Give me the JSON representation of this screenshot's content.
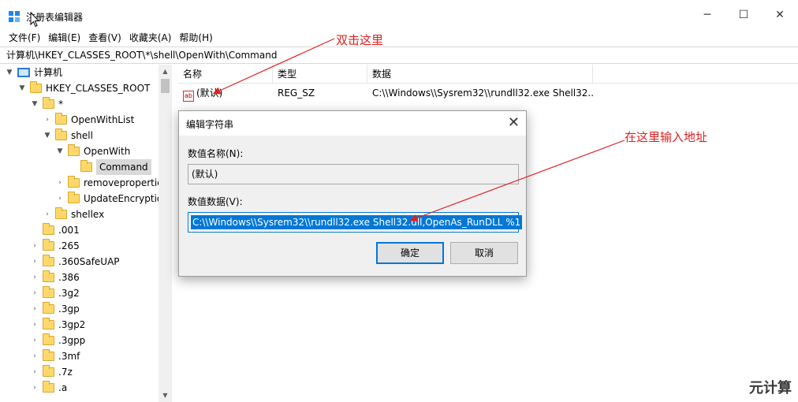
{
  "window": {
    "title": "注册表编辑器",
    "minimize_glyph": "─",
    "maximize_glyph": "☐",
    "close_glyph": "✕"
  },
  "menu": [
    "文件(F)",
    "编辑(E)",
    "查看(V)",
    "收藏夹(A)",
    "帮助(H)"
  ],
  "address": "计算机\\HKEY_CLASSES_ROOT\\*\\shell\\OpenWith\\Command",
  "tree": [
    {
      "label": "计算机",
      "twisty": "▼",
      "indent": 0,
      "icon": "computer"
    },
    {
      "label": "HKEY_CLASSES_ROOT",
      "twisty": "▼",
      "indent": 1,
      "icon": "folder"
    },
    {
      "label": "*",
      "twisty": "▼",
      "indent": 2,
      "icon": "folder"
    },
    {
      "label": "OpenWithList",
      "twisty": "›",
      "indent": 3,
      "icon": "folder"
    },
    {
      "label": "shell",
      "twisty": "▼",
      "indent": 3,
      "icon": "folder"
    },
    {
      "label": "OpenWith",
      "twisty": "▼",
      "indent": 4,
      "icon": "folder"
    },
    {
      "label": "Command",
      "twisty": "",
      "indent": 5,
      "icon": "folder",
      "selected": true
    },
    {
      "label": "removepropertie",
      "twisty": "›",
      "indent": 4,
      "icon": "folder"
    },
    {
      "label": "UpdateEncryptio",
      "twisty": "›",
      "indent": 4,
      "icon": "folder"
    },
    {
      "label": "shellex",
      "twisty": "›",
      "indent": 3,
      "icon": "folder"
    },
    {
      "label": ".001",
      "twisty": "",
      "indent": 2,
      "icon": "folder"
    },
    {
      "label": ".265",
      "twisty": "›",
      "indent": 2,
      "icon": "folder"
    },
    {
      "label": ".360SafeUAP",
      "twisty": "›",
      "indent": 2,
      "icon": "folder"
    },
    {
      "label": ".386",
      "twisty": "›",
      "indent": 2,
      "icon": "folder"
    },
    {
      "label": ".3g2",
      "twisty": "›",
      "indent": 2,
      "icon": "folder"
    },
    {
      "label": ".3gp",
      "twisty": "›",
      "indent": 2,
      "icon": "folder"
    },
    {
      "label": ".3gp2",
      "twisty": "›",
      "indent": 2,
      "icon": "folder"
    },
    {
      "label": ".3gpp",
      "twisty": "›",
      "indent": 2,
      "icon": "folder"
    },
    {
      "label": ".3mf",
      "twisty": "›",
      "indent": 2,
      "icon": "folder"
    },
    {
      "label": ".7z",
      "twisty": "›",
      "indent": 2,
      "icon": "folder"
    },
    {
      "label": ".a",
      "twisty": "›",
      "indent": 2,
      "icon": "folder"
    }
  ],
  "list": {
    "headers": [
      "名称",
      "类型",
      "数据"
    ],
    "rows": [
      {
        "icon": "ab",
        "name": "(默认)",
        "type": "REG_SZ",
        "data": "C:\\\\Windows\\\\Sysrem32\\\\rundll32.exe Shell32..."
      }
    ]
  },
  "dialog": {
    "title": "编辑字符串",
    "close_glyph": "✕",
    "name_label": "数值名称(N):",
    "name_value": "(默认)",
    "data_label": "数值数据(V):",
    "data_value": "C:\\\\Windows\\\\Sysrem32\\\\rundll32.exe Shell32.dll,OpenAs_RunDLL %1",
    "ok_label": "确定",
    "cancel_label": "取消"
  },
  "annotations": {
    "double_click": "双击这里",
    "enter_here": "在这里输入地址",
    "color": "#e02020"
  },
  "watermark": "元计算",
  "scroll": {
    "up_glyph": "▲",
    "down_glyph": "▼"
  }
}
